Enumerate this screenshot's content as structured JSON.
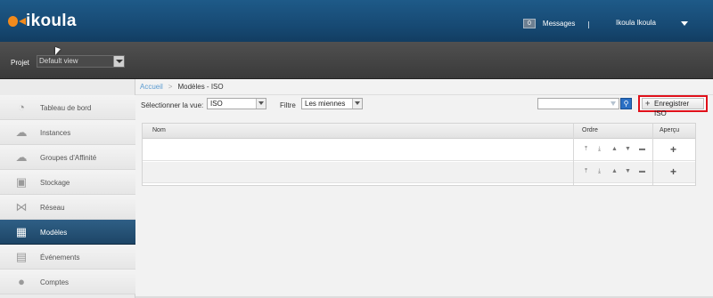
{
  "header": {
    "logo_text": "ikoula",
    "messages_count": "0",
    "messages_label": "Messages",
    "user_name": "Ikoula Ikoula"
  },
  "project": {
    "label": "Projet",
    "selected": "Default view"
  },
  "sidebar": {
    "items": [
      {
        "label": "Tableau de bord",
        "icon": "dashboard-icon"
      },
      {
        "label": "Instances",
        "icon": "cloud-icon"
      },
      {
        "label": "Groupes d'Affinité",
        "icon": "affinity-icon"
      },
      {
        "label": "Stockage",
        "icon": "storage-icon"
      },
      {
        "label": "Réseau",
        "icon": "network-icon"
      },
      {
        "label": "Modèles",
        "icon": "templates-icon",
        "active": true
      },
      {
        "label": "Événements",
        "icon": "calendar-icon"
      },
      {
        "label": "Comptes",
        "icon": "user-icon"
      }
    ]
  },
  "breadcrumb": {
    "home": "Accueil",
    "separator": ">",
    "current": "Modèles - ISO"
  },
  "filters": {
    "view_label": "Sélectionner la vue:",
    "view_value": "ISO",
    "filter_label": "Filtre",
    "filter_value": "Les miennes",
    "search_placeholder": ""
  },
  "actions": {
    "register_iso": "Enregistrer ISO"
  },
  "table": {
    "columns": [
      "Nom",
      "Ordre",
      "Aperçu"
    ],
    "rows": [
      {
        "name": ""
      },
      {
        "name": ""
      }
    ]
  },
  "colors": {
    "header_blue": "#1e5a88",
    "active_nav": "#2f5f86",
    "highlight_red": "#e0101a",
    "link_blue": "#5b9bd1"
  }
}
